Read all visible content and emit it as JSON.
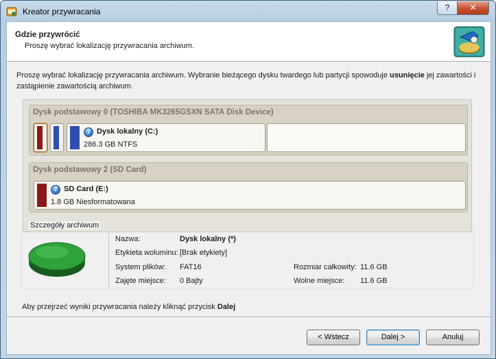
{
  "window": {
    "title": "Kreator przywracania",
    "help_label": "?",
    "close_label": "✕"
  },
  "header": {
    "title": "Gdzie przywrócić",
    "subtitle": "Proszę wybrać lokalizację przywracania archiwum."
  },
  "intro": {
    "text_before": "Proszę wybrać lokalizację przywracania archiwum. Wybranie bieżącego dysku twardego lub partycji spowoduje ",
    "bold": "usunięcie",
    "text_after": " jej zawartości i zastąpienie zawartością archiwum."
  },
  "disks": [
    {
      "title": "Dysk podstawowy 0 (TOSHIBA MK3265GSXN SATA Disk Device)",
      "partition": {
        "name": "Dysk lokalny (C:)",
        "info": "286.3 GB NTFS"
      }
    },
    {
      "title": "Dysk podstawowy 2 (SD Card)",
      "partition": {
        "name": "SD Card (E:)",
        "info": "1.8 GB Niesformatowana"
      }
    }
  ],
  "details": {
    "section_label": "Szczegóły archiwum",
    "name_label": "Nazwa:",
    "name_value": "Dysk lokalny (*)",
    "volume_label": "Etykieta woluminu:",
    "volume_value": "[Brak etykiety]",
    "fs_label": "System plików:",
    "fs_value": "FAT16",
    "used_label": "Zajęte miejsce:",
    "used_value": "0 Bajty",
    "total_label": "Rozmiar całkowity:",
    "total_value": "11.6 GB",
    "free_label": "Wolne miejsce:",
    "free_value": "11.6 GB"
  },
  "hint": {
    "text": "Aby przejrzeć wyniki przywracania należy kliknąć przycisk ",
    "bold": "Dalej"
  },
  "buttons": {
    "back": "< Wstecz",
    "next": "Dalej >",
    "cancel": "Anuluj"
  },
  "colors": {
    "system_bar": "#8b1a1a",
    "partition_bar": "#2f4fb0",
    "disk_icon": "#2fa33a"
  }
}
